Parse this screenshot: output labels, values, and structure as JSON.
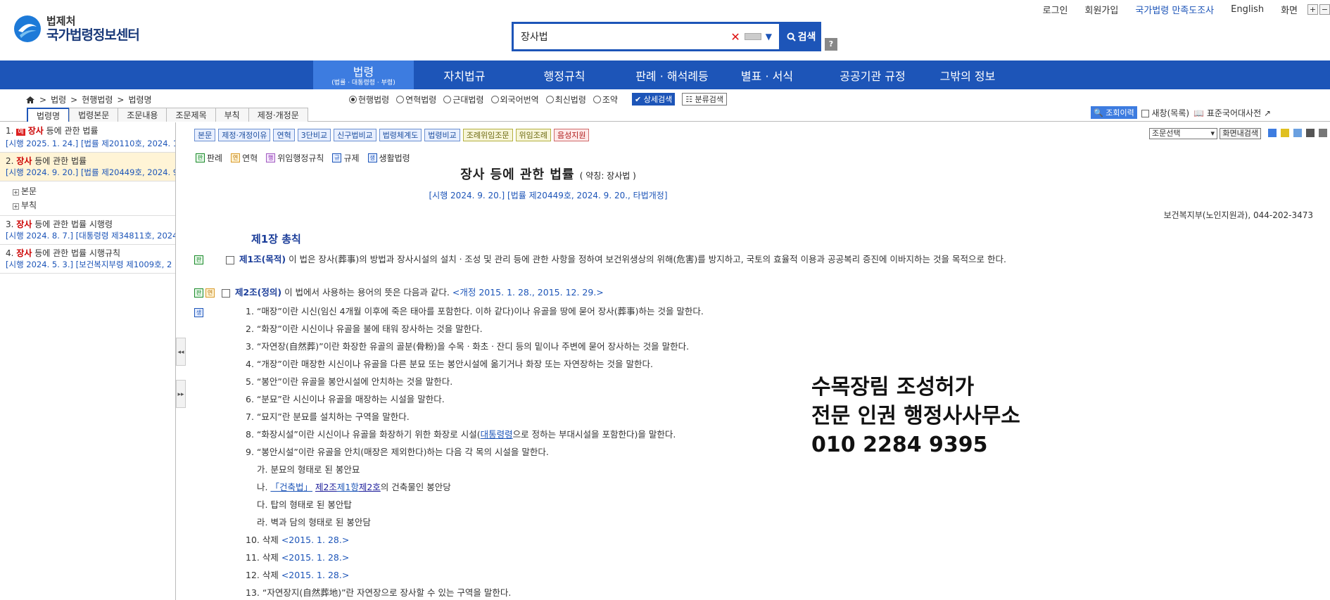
{
  "header": {
    "logo_line1": "법제처",
    "logo_line2": "국가법령정보센터",
    "search_value": "장사법",
    "search_button": "검색",
    "help": "?",
    "top_links": [
      "로그인",
      "회원가입",
      "국가법령 만족도조사",
      "English",
      "화면"
    ],
    "zoom_plus": "+",
    "zoom_minus": "−"
  },
  "nav": {
    "items": [
      "법령",
      "자치법규",
      "행정규칙",
      "판례 · 해석례등",
      "별표 · 서식",
      "공공기관 규정",
      "그밖의 정보"
    ],
    "active_sub": "(법률 · 대통령령 · 부령)"
  },
  "subnav": {
    "breadcrumb": [
      "법령",
      "현행법령",
      "법령명"
    ],
    "radios": [
      "현행법령",
      "연혁법령",
      "근대법령",
      "외국어번역",
      "최신법령",
      "조약"
    ],
    "detail_search": "상세검색",
    "category_search": "분류검색",
    "side_tabs": [
      "법령명",
      "법령본문",
      "조문내용",
      "조문제목",
      "부칙",
      "제정·개정문"
    ],
    "views": "조회이력",
    "new_items": "새창(목록)",
    "dictionary": "표준국어대사전"
  },
  "sidebar": {
    "items": [
      {
        "num": "1.",
        "badge": "예",
        "kw": "장사",
        "rest": " 등에 관한 법률",
        "meta": "[시행 2025. 1. 24.] [법률 제20110호, 2024. 1"
      },
      {
        "num": "2.",
        "badge": "",
        "kw": "장사",
        "rest": " 등에 관한 법률",
        "meta": "[시행 2024. 9. 20.] [법률 제20449호, 2024. 9"
      },
      {
        "num": "3.",
        "badge": "",
        "kw": "장사",
        "rest": " 등에 관한 법률 시행령",
        "meta": "[시행 2024. 8. 7.] [대통령령 제34811호, 2024"
      },
      {
        "num": "4.",
        "badge": "",
        "kw": "장사",
        "rest": " 등에 관한 법률 시행규칙",
        "meta": "[시행 2024. 5. 3.] [보건복지부령 제1009호, 2"
      }
    ],
    "tree": [
      "본문",
      "부칙"
    ],
    "handle_left": "◂◂",
    "handle_right": "▸▸"
  },
  "toolbar": {
    "buttons": [
      "본문",
      "제정·개정이유",
      "연혁",
      "3단비교",
      "신구법비교",
      "법령체계도",
      "법령비교"
    ],
    "yellow_buttons": [
      "조례위임조문",
      "위임조례"
    ],
    "red_button": "음성지원",
    "select": "조문선택",
    "screen_search": "화면내검색"
  },
  "legend": [
    {
      "chip": "판",
      "label": "판례"
    },
    {
      "chip": "연",
      "label": "연혁"
    },
    {
      "chip": "행",
      "label": "위임행정규칙"
    },
    {
      "chip": "규",
      "label": "규제"
    },
    {
      "chip": "생",
      "label": "생활법령"
    }
  ],
  "law": {
    "title": "장사 등에 관한 법률",
    "short": "( 약칭: 장사법 )",
    "enforce": "[시행 2024. 9. 20.] [법률 제20449호, 2024. 9. 20., 타법개정]",
    "ministry": "보건복지부(노인지원과), 044-202-3473",
    "chapter": "제1장 총칙",
    "art1_no": "제1조(목적)",
    "art1_text": " 이 법은 장사(葬事)의 방법과 장사시설의 설치ㆍ조성 및 관리 등에 관한 사항을 정하여 보건위생상의 위해(危害)를 방지하고, 국토의 효율적 이용과 공공복리 증진에 이바지하는 것을 목적으로 한다.",
    "art2_no": "제2조(정의)",
    "art2_text": " 이 법에서 사용하는 용어의 뜻은 다음과 같다.",
    "art2_rev": "<개정 2015. 1. 28., 2015. 12. 29.>",
    "items": [
      "1. “매장”이란 시신(임신 4개월 이후에 죽은 태아를 포함한다. 이하 같다)이나 유골을 땅에 묻어 장사(葬事)하는 것을 말한다.",
      "2. “화장”이란 시신이나 유골을 불에 태워 장사하는 것을 말한다.",
      "3. “자연장(自然葬)”이란 화장한 유골의 골분(骨粉)을 수목ㆍ화초ㆍ잔디 등의 밑이나 주변에 묻어 장사하는 것을 말한다.",
      "4. “개장”이란 매장한 시신이나 유골을 다른 분묘 또는 봉안시설에 옮기거나 화장 또는 자연장하는 것을 말한다.",
      "5. “봉안”이란 유골을 봉안시설에 안치하는 것을 말한다.",
      "6. “분묘”란 시신이나 유골을 매장하는 시설을 말한다.",
      "7. “묘지”란 분묘를 설치하는 구역을 말한다."
    ],
    "item8_pre": "8. “화장시설”이란 시신이나 유골을 화장하기 위한 화장로 시설(",
    "item8_link": "대통령령",
    "item8_post": "으로 정하는 부대시설을 포함한다)을 말한다.",
    "item9": "9. “봉안시설”이란 유골을 안치(매장은 제외한다)하는 다음 각 목의 시설을 말한다.",
    "item9a": "가. 분묘의 형태로 된 봉안묘",
    "item9b_pre": "나. ",
    "item9b_link1": "「건축법」",
    "item9b_link2": "제2조",
    "item9b_link3": "제1항",
    "item9b_link4": "제2호",
    "item9b_post": "의 건축물인 봉안당",
    "item9c": "다. 탑의 형태로 된 봉안탑",
    "item9d": "라. 벽과 담의 형태로 된 봉안담",
    "item10": "10. 삭제 ",
    "item10_date": "<2015. 1. 28.>",
    "item11": "11. 삭제 ",
    "item11_date": "<2015. 1. 28.>",
    "item12": "12. 삭제 ",
    "item12_date": "<2015. 1. 28.>",
    "item13": "13. “자연장지(自然葬地)”란 자연장으로 장사할 수 있는 구역을 말한다."
  },
  "ad": {
    "line1": "수목장림 조성허가",
    "line2": "전문 인권 행정사사무소",
    "line3": "010 2284 9395"
  },
  "colors": {
    "primary": "#1d55b8",
    "active_nav": "#3d7ce0",
    "keyword": "#cc0000"
  }
}
